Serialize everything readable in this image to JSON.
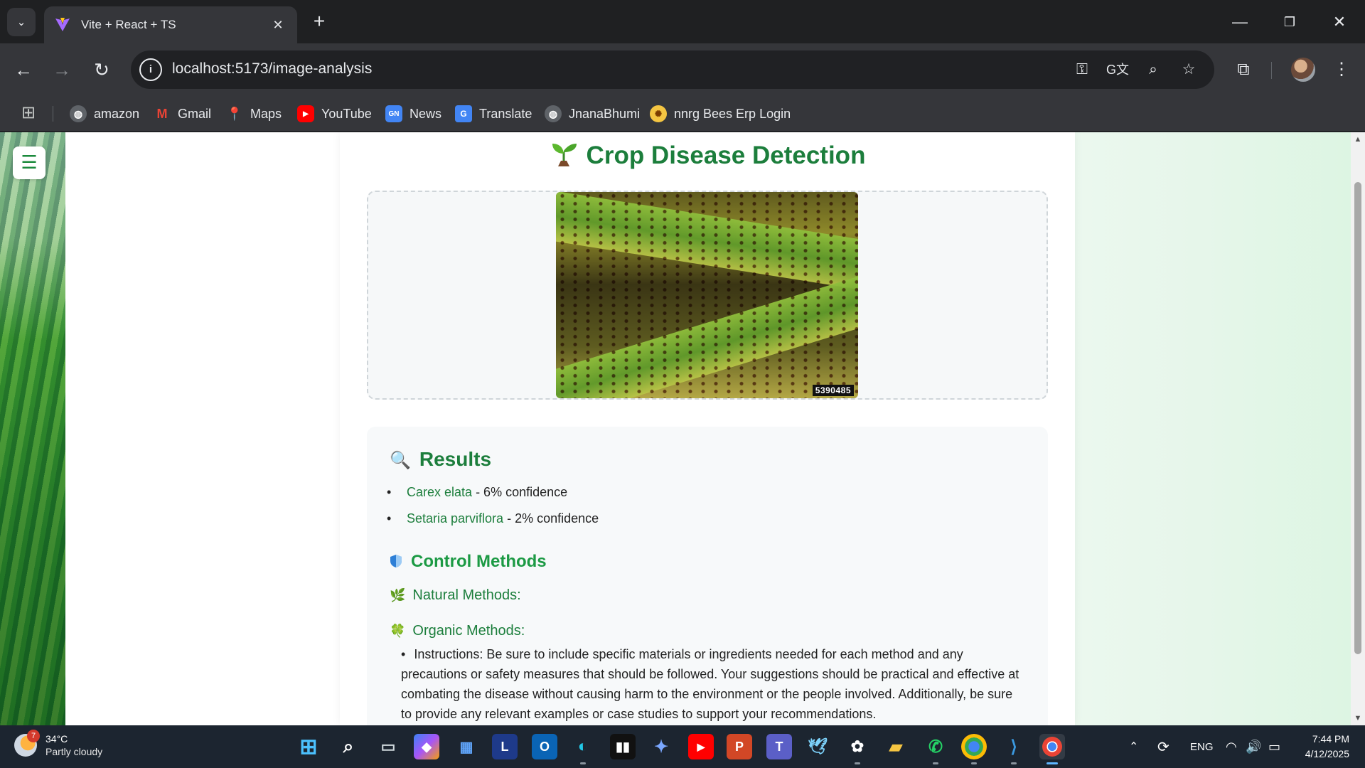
{
  "browser": {
    "tab_title": "Vite + React + TS",
    "url": "localhost:5173/image-analysis",
    "bookmarks": [
      {
        "label": "amazon",
        "icon": "globe-icon"
      },
      {
        "label": "Gmail",
        "icon": "gmail-icon"
      },
      {
        "label": "Maps",
        "icon": "maps-icon"
      },
      {
        "label": "YouTube",
        "icon": "youtube-icon"
      },
      {
        "label": "News",
        "icon": "news-icon"
      },
      {
        "label": "Translate",
        "icon": "translate-icon"
      },
      {
        "label": "JnanaBhumi",
        "icon": "globe-icon"
      },
      {
        "label": "nnrg Bees Erp Login",
        "icon": "nnrg-logo-icon"
      }
    ]
  },
  "page": {
    "title": "Crop Disease Detection",
    "uploaded_image_id": "5390485",
    "results": {
      "heading": "Results",
      "items": [
        {
          "species": "Carex elata",
          "confidence": " - 6% confidence"
        },
        {
          "species": "Setaria parviflora",
          "confidence": " - 2% confidence"
        }
      ]
    },
    "control": {
      "heading": "Control Methods",
      "natural_label": "Natural Methods:",
      "organic_label": "Organic Methods:",
      "instructions": "Instructions: Be sure to include specific materials or ingredients needed for each method and any precautions or safety measures that should be followed. Your suggestions should be practical and effective at combating the disease without causing harm to the environment or the people involved. Additionally, be sure to provide any relevant examples or case studies to support your recommendations."
    }
  },
  "taskbar": {
    "weather_badge": "7",
    "temperature": "34°C",
    "condition": "Partly cloudy",
    "language": "ENG",
    "time": "7:44 PM",
    "date": "4/12/2025"
  },
  "colors": {
    "accent_green": "#1c7e3c",
    "browser_dark": "#35363a",
    "taskbar": "#1c2530"
  }
}
